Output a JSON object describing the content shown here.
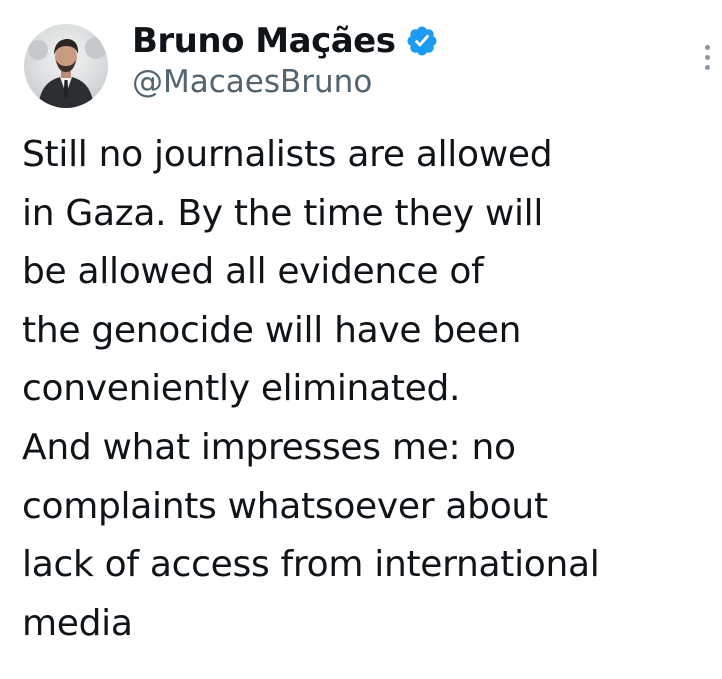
{
  "author": {
    "display_name": "Bruno Maçães",
    "handle": "@MacaesBruno",
    "verified": true,
    "avatar_icon": "avatar-photo",
    "verified_icon": "verified-badge-icon",
    "verified_color": "#1d9bf0"
  },
  "menu": {
    "icon": "more-vertical-icon"
  },
  "tweet": {
    "lines": [
      "Still no journalists are allowed",
      "in Gaza. By the time they will",
      "be allowed all evidence of",
      "the genocide will have been",
      "conveniently eliminated.",
      "And what impresses me: no",
      "complaints whatsoever about",
      "lack of access from international",
      "media"
    ]
  },
  "colors": {
    "text": "#0f1419",
    "secondary": "#536471",
    "background": "#ffffff"
  }
}
